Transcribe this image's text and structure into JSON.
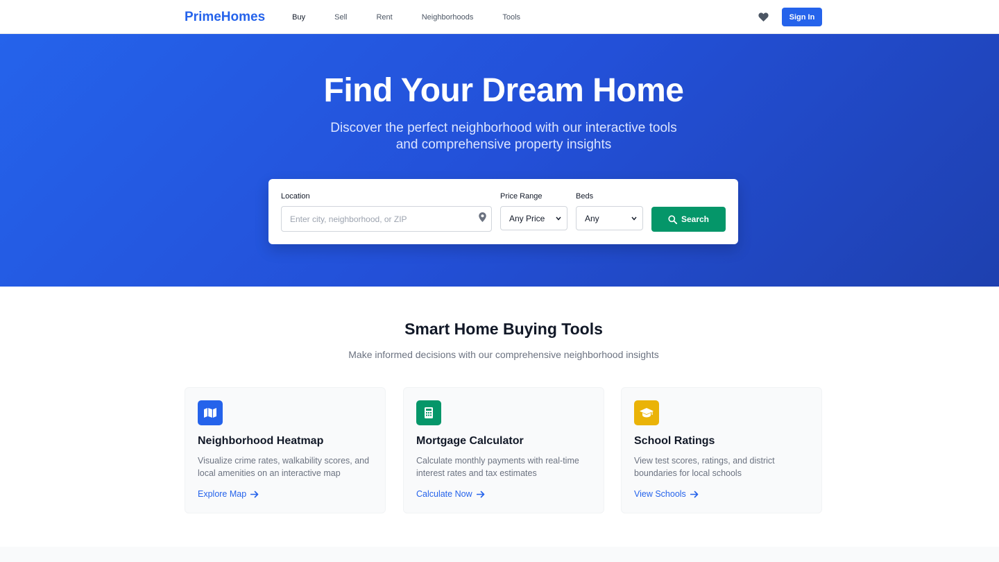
{
  "brand": {
    "name": "PrimeHomes",
    "color": "#2563eb"
  },
  "nav": {
    "links": [
      "Buy",
      "Sell",
      "Rent",
      "Neighborhoods",
      "Tools"
    ],
    "signin_label": "Sign In"
  },
  "hero": {
    "title": "Find Your Dream Home",
    "subtitle": "Discover the perfect neighborhood with our interactive tools and comprehensive property insights"
  },
  "search": {
    "location_label": "Location",
    "location_placeholder": "Enter city, neighborhood, or ZIP",
    "location_value": "",
    "price_label": "Price Range",
    "price_value": "Any Price",
    "beds_label": "Beds",
    "beds_value": "Any",
    "button_label": "Search",
    "button_color": "#059669"
  },
  "tools": {
    "title": "Smart Home Buying Tools",
    "subtitle": "Make informed decisions with our comprehensive neighborhood insights",
    "cards": [
      {
        "icon": "map-icon",
        "icon_color": "#2563eb",
        "title": "Neighborhood Heatmap",
        "description": "Visualize crime rates, walkability scores, and local amenities on an interactive map",
        "link": "Explore Map"
      },
      {
        "icon": "calculator-icon",
        "icon_color": "#059669",
        "title": "Mortgage Calculator",
        "description": "Calculate monthly payments with real-time interest rates and tax estimates",
        "link": "Calculate Now"
      },
      {
        "icon": "graduation-cap-icon",
        "icon_color": "#eab308",
        "title": "School Ratings",
        "description": "View test scores, ratings, and district boundaries for local schools",
        "link": "View Schools"
      }
    ]
  }
}
